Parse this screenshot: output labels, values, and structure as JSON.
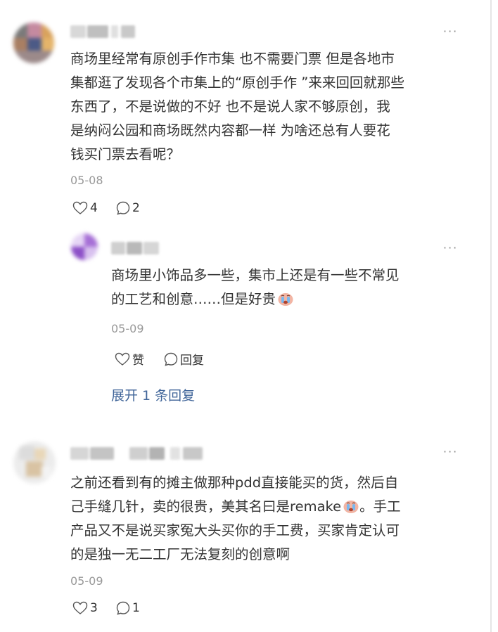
{
  "comments": [
    {
      "text": "商场里经常有原创手作市集 也不需要门票 但是各地市集都逛了发现各个市集上的“原创手作 ”来来回回就那些东西了，不是说做的不好 也不是说人家不够原创，我是纳闷公园和商场既然内容都一样 为啥还总有人要花钱买门票去看呢？",
      "lines": [
        "商场里经常有原创手作市集 也不需要门票 但是各地市",
        "集都逛了发现各个市集上的“原创手作 ”来来回回就那些",
        "东西了，不是说做的不好 也不是说人家不够原创，我",
        "是纳闷公园和商场既然内容都一样 为啥还总有人要花",
        "钱买门票去看呢？"
      ],
      "date": "05-08",
      "likes": "4",
      "replies": "2",
      "more_icon": "···",
      "reply": {
        "text": "商场里小饰品多一些，集市上还是有一些不常见的工艺和创意……但是好贵",
        "line1": "商场里小饰品多一些，集市上还是有一些不常见",
        "line2": "的工艺和创意……但是好贵",
        "emoji": "crying-face-emoji",
        "date": "05-09",
        "like_label": "赞",
        "reply_label": "回复",
        "more_icon": "···"
      },
      "expand_label": "展开 1 条回复"
    },
    {
      "text": "之前还看到有的摊主做那种pdd直接能买的货，然后自己手缝几针，卖的很贵，美其名曰是remake。手工产品又不是说买家冤大头买你的手工费，买家肯定认可的是独一无二工厂无法复刻的创意啊",
      "line1": "之前还看到有的摊主做那种pdd直接能买的货，然后自",
      "line2_a": "己手缝几针，卖的很贵，美其名曰是remake",
      "line2_b": "。手工",
      "line3": "产品又不是说买家冤大头买你的手工费，买家肯定认可",
      "line4": "的是独一无二工厂无法复刻的创意啊",
      "emoji": "crying-face-emoji",
      "date": "05-09",
      "likes": "3",
      "replies": "1",
      "more_icon": "···"
    }
  ],
  "colors": {
    "text": "#333333",
    "meta": "#999999",
    "link": "#406599"
  }
}
